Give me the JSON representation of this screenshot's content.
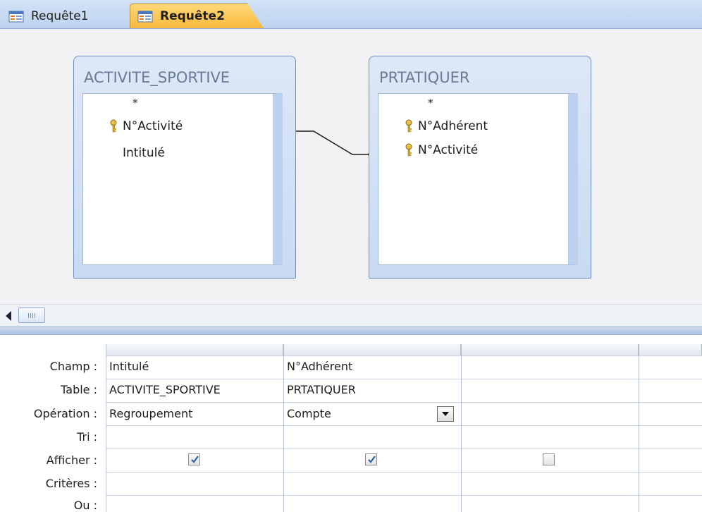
{
  "tabs": [
    {
      "label": "Requête1",
      "active": false,
      "icon": "query-icon"
    },
    {
      "label": "Requête2",
      "active": true,
      "icon": "query-icon"
    }
  ],
  "tables": [
    {
      "name": "ACTIVITE_SPORTIVE",
      "fields": [
        "*",
        "N°Activité",
        "Intitulé"
      ],
      "key_fields": [
        "N°Activité"
      ]
    },
    {
      "name": "PRTATIQUER",
      "fields": [
        "*",
        "N°Adhérent",
        "N°Activité"
      ],
      "key_fields": [
        "N°Adhérent",
        "N°Activité"
      ]
    }
  ],
  "grid": {
    "row_labels": [
      "Champ :",
      "Table :",
      "Opération :",
      "Tri :",
      "Afficher :",
      "Critères :",
      "Ou :"
    ],
    "columns": [
      {
        "champ": "Intitulé",
        "table": "ACTIVITE_SPORTIVE",
        "operation": "Regroupement",
        "afficher": true
      },
      {
        "champ": "N°Adhérent",
        "table": "PRTATIQUER",
        "operation": "Compte",
        "afficher": true
      },
      {
        "champ": "",
        "table": "",
        "operation": "",
        "afficher": false
      }
    ]
  },
  "colors": {
    "active_tab": "#f7b83c",
    "tab_bar": "#bcd3ef",
    "table_border": "#6c8fbd",
    "check": "#2b5fa6"
  }
}
